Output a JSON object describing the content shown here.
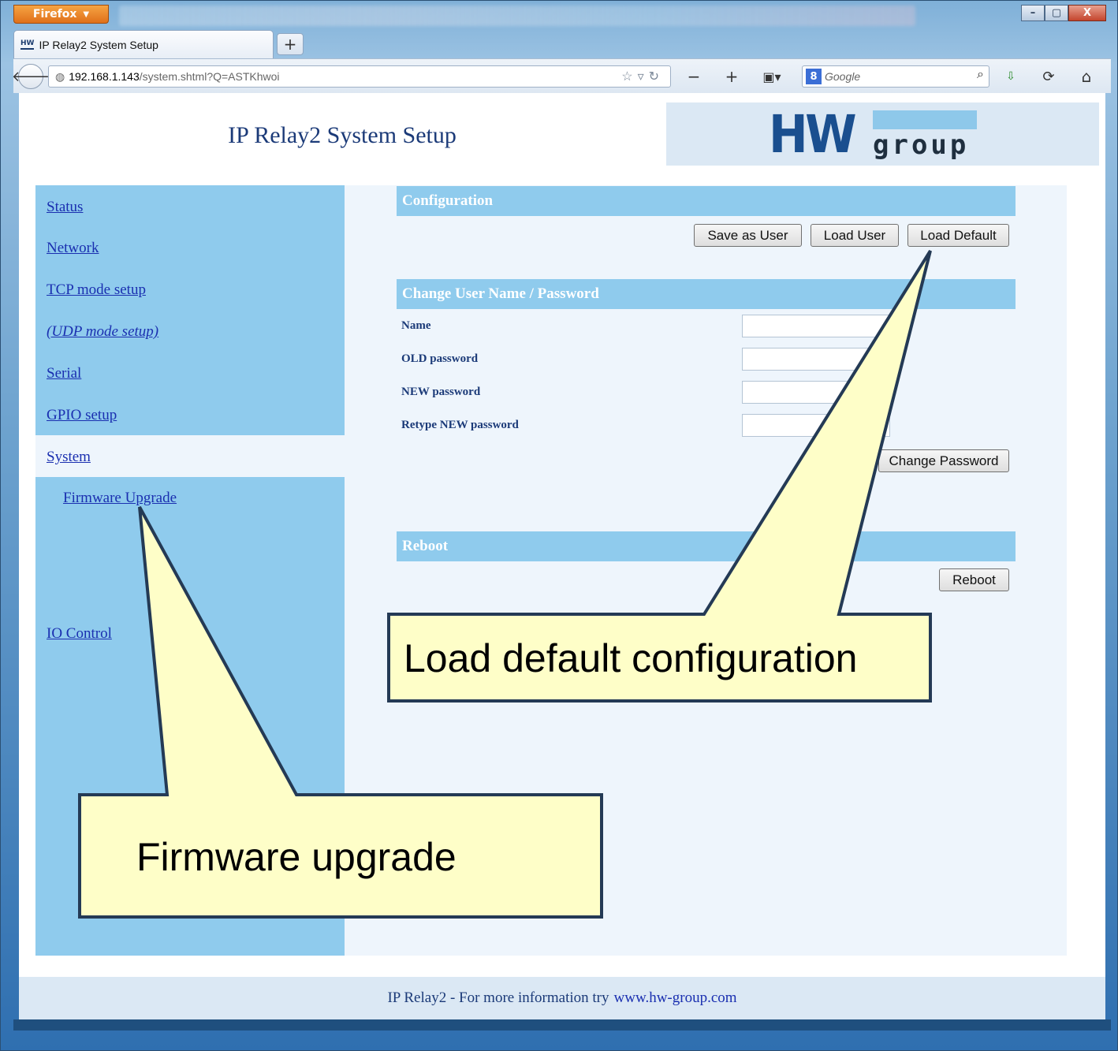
{
  "browser": {
    "menu_button": "Firefox",
    "tab_title": "IP Relay2 System Setup",
    "tab_favicon": "HW",
    "new_tab": "+",
    "url_host": "192.168.1.143",
    "url_path": "/system.shtml?Q=ASTKhwoi",
    "search_engine_badge": "8",
    "search_placeholder": "Google",
    "window_controls": [
      "–",
      "▢",
      "X"
    ]
  },
  "header": {
    "title": "IP Relay2 System Setup",
    "logo_hw": "HW",
    "logo_group": "group"
  },
  "sidebar": {
    "items": [
      {
        "label": "Status"
      },
      {
        "label": "Network"
      },
      {
        "label": "TCP mode setup"
      },
      {
        "label": "(UDP mode setup)"
      },
      {
        "label": "Serial"
      },
      {
        "label": "GPIO setup"
      },
      {
        "label": "System"
      },
      {
        "label": "Firmware Upgrade"
      },
      {
        "label": "IO Control"
      }
    ]
  },
  "configuration": {
    "header": "Configuration",
    "save_as_user": "Save as User",
    "load_user": "Load User",
    "load_default": "Load Default"
  },
  "password": {
    "header": "Change User Name / Password",
    "name_label": "Name",
    "old_label": "OLD password",
    "new_label": "NEW password",
    "retype_label": "Retype NEW password",
    "change_button": "Change Password"
  },
  "reboot": {
    "header": "Reboot",
    "button": "Reboot"
  },
  "footer": {
    "text": "IP Relay2 - For more information try",
    "link": "www.hw-group.com"
  },
  "callouts": {
    "load_default": "Load default configuration",
    "firmware": "Firmware upgrade"
  },
  "colors": {
    "sidebar": "#8fcbed",
    "content_bg": "#eef5fc",
    "callout_fill": "#fefec8",
    "callout_border": "#243a55"
  }
}
